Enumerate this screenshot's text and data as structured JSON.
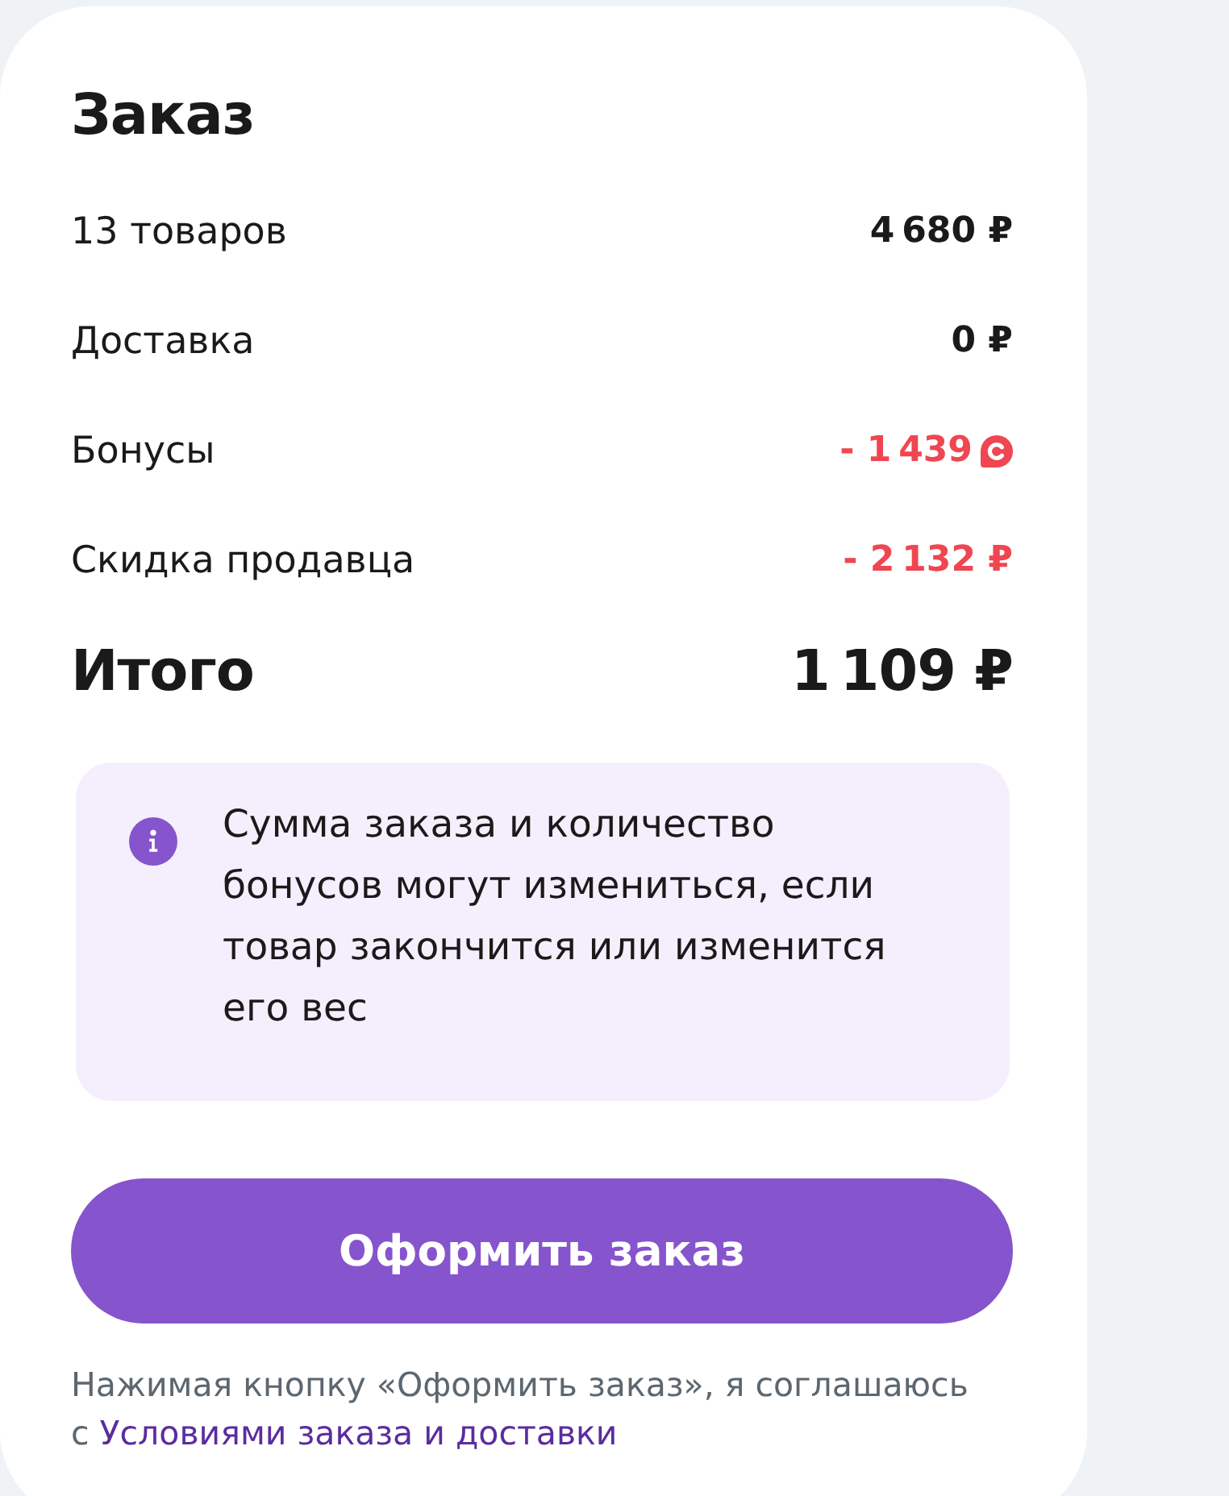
{
  "title": "Заказ",
  "summary": [
    {
      "label": "13 товаров",
      "value": "4 680 ₽",
      "kind": "plain"
    },
    {
      "label": "Доставка",
      "value": "0 ₽",
      "kind": "plain"
    },
    {
      "label": "Бонусы",
      "value": "- 1 439",
      "kind": "bonus"
    },
    {
      "label": "Скидка продавца",
      "value": "- 2 132 ₽",
      "kind": "discount"
    }
  ],
  "total": {
    "label": "Итого",
    "value": "1 109 ₽"
  },
  "notice": {
    "text": "Сумма заказа и количество бонусов могут измениться, если товар закончится или изменится его вес"
  },
  "checkout_button": {
    "label": "Оформить заказ"
  },
  "terms": {
    "text": "Нажимая кнопку «Оформить заказ», я соглашаюсь с",
    "link": "Условиями заказа и доставки"
  }
}
